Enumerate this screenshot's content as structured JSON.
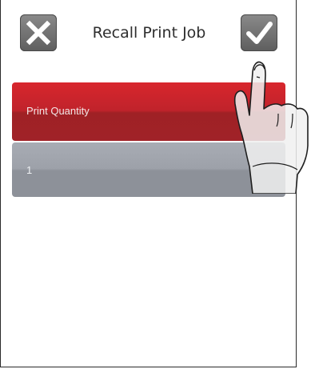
{
  "header": {
    "title": "Recall Print Job",
    "cancel_icon": "close-icon",
    "confirm_icon": "checkmark-icon"
  },
  "field": {
    "label": "Print Quantity",
    "value": "1"
  },
  "overlay": {
    "icon": "pointing-hand-icon"
  },
  "colors": {
    "field_label_bg": "#c0232b",
    "field_value_bg": "#9da1a9",
    "button_bg": "#6f6f6f"
  }
}
